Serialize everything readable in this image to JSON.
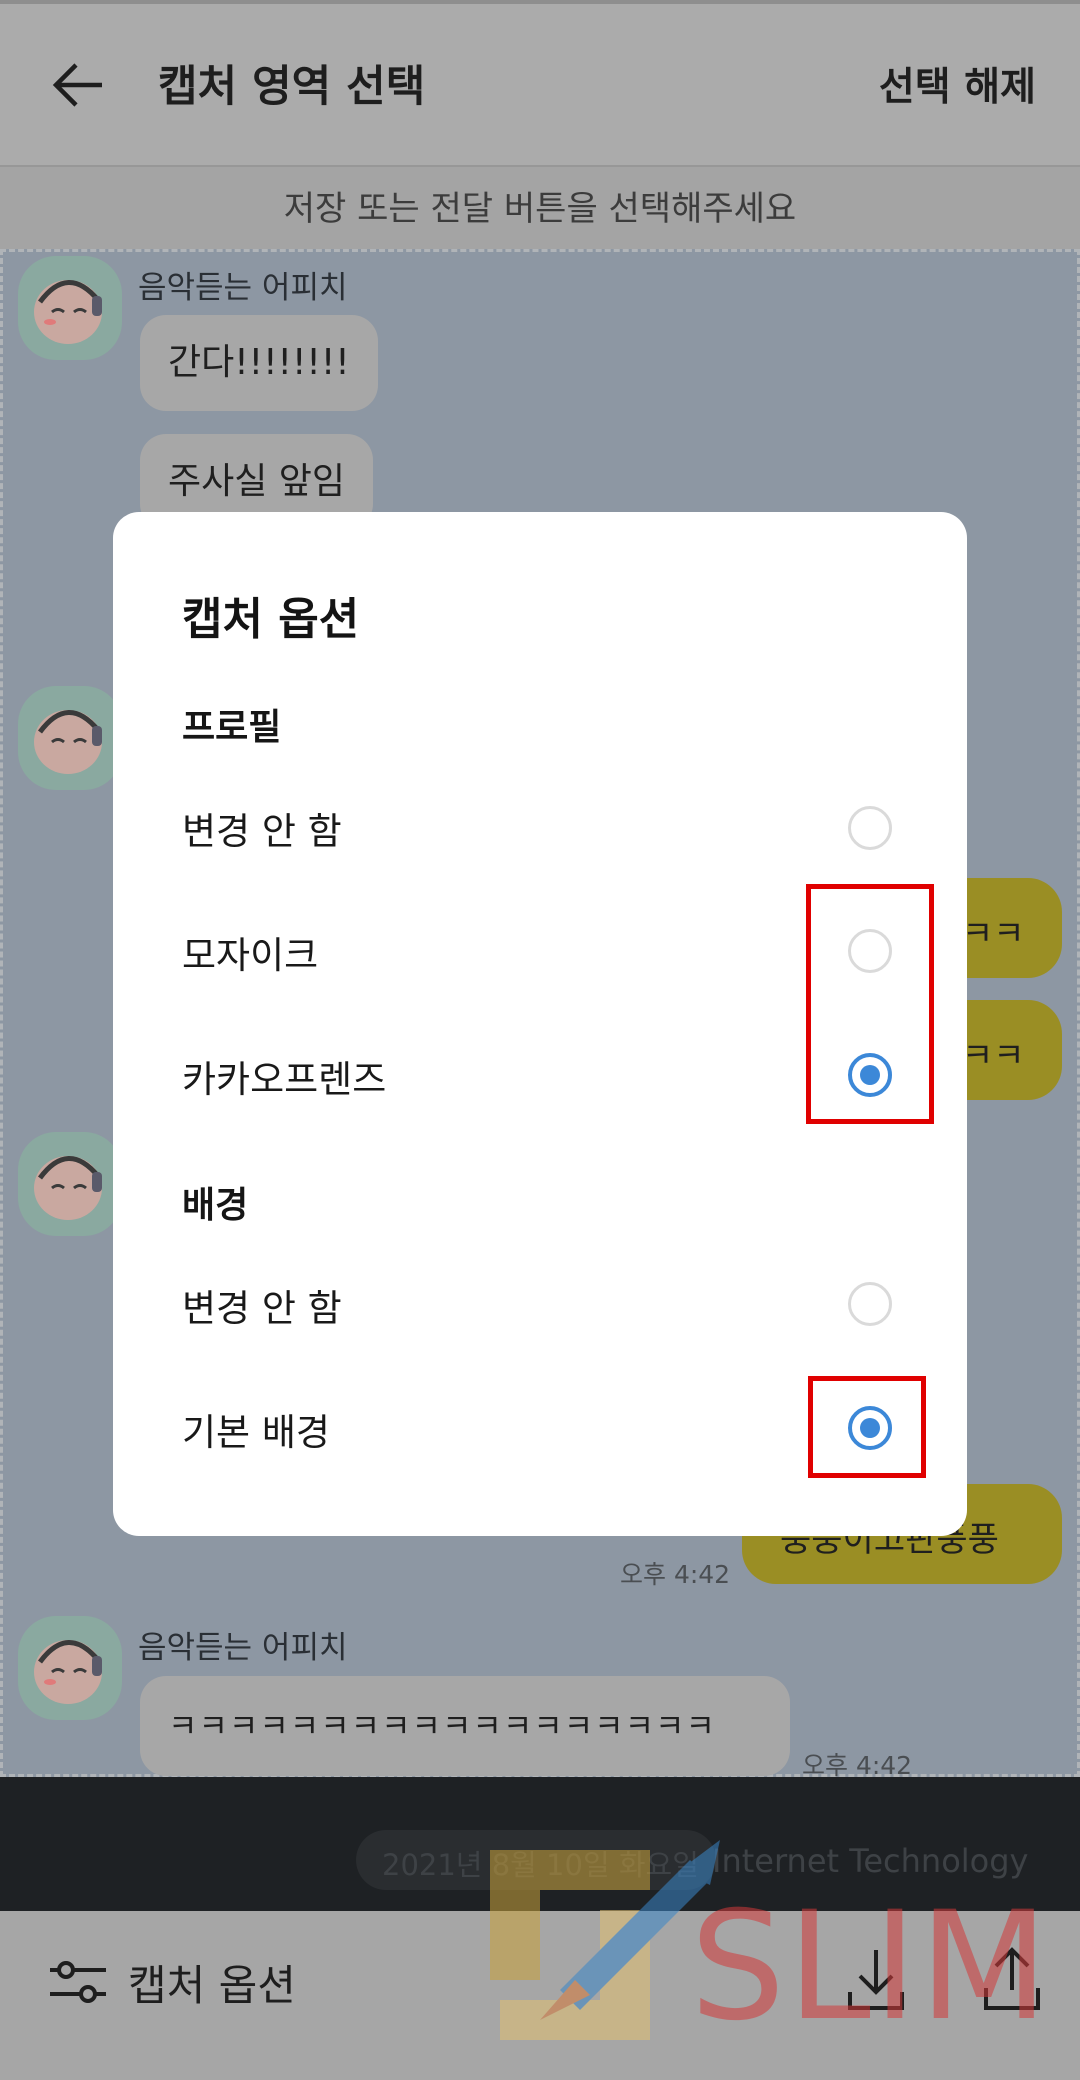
{
  "header": {
    "title": "캡처 영역 선택",
    "deselect_label": "선택 해제"
  },
  "banner": {
    "text": "저장 또는 전달 버튼을 선택해주세요"
  },
  "chat": {
    "sender_1": "음악듣는 어피치",
    "msg_1": "간다!!!!!!!!",
    "msg_2": "주사실 앞임",
    "yellow_1": "ㅋㅋ",
    "yellow_2": "ㅋㅋ",
    "yellow_3": "풍풍이고판풍풍",
    "time_1": "오후 4:42",
    "sender_2": "음악듣는 어피치",
    "msg_3": "ㅋㅋㅋㅋㅋㅋㅋㅋㅋㅋㅋㅋㅋㅋㅋㅋㅋㅋ",
    "time_2": "오후 4:42",
    "date_pill": "2021년 8월 10일 화요일"
  },
  "dialog": {
    "title": "캡처 옵션",
    "profile": {
      "section": "프로필",
      "options": [
        {
          "label": "변경 안 함",
          "selected": false
        },
        {
          "label": "모자이크",
          "selected": false
        },
        {
          "label": "카카오프렌즈",
          "selected": true
        }
      ]
    },
    "background": {
      "section": "배경",
      "options": [
        {
          "label": "변경 안 함",
          "selected": false
        },
        {
          "label": "기본 배경",
          "selected": true
        }
      ]
    }
  },
  "bottom": {
    "capture_options_label": "캡처 옵션"
  },
  "watermark": {
    "text": "SLIM",
    "site": "Internet Technology"
  },
  "colors": {
    "accent": "#3c88d8",
    "highlight": "#e00000"
  }
}
